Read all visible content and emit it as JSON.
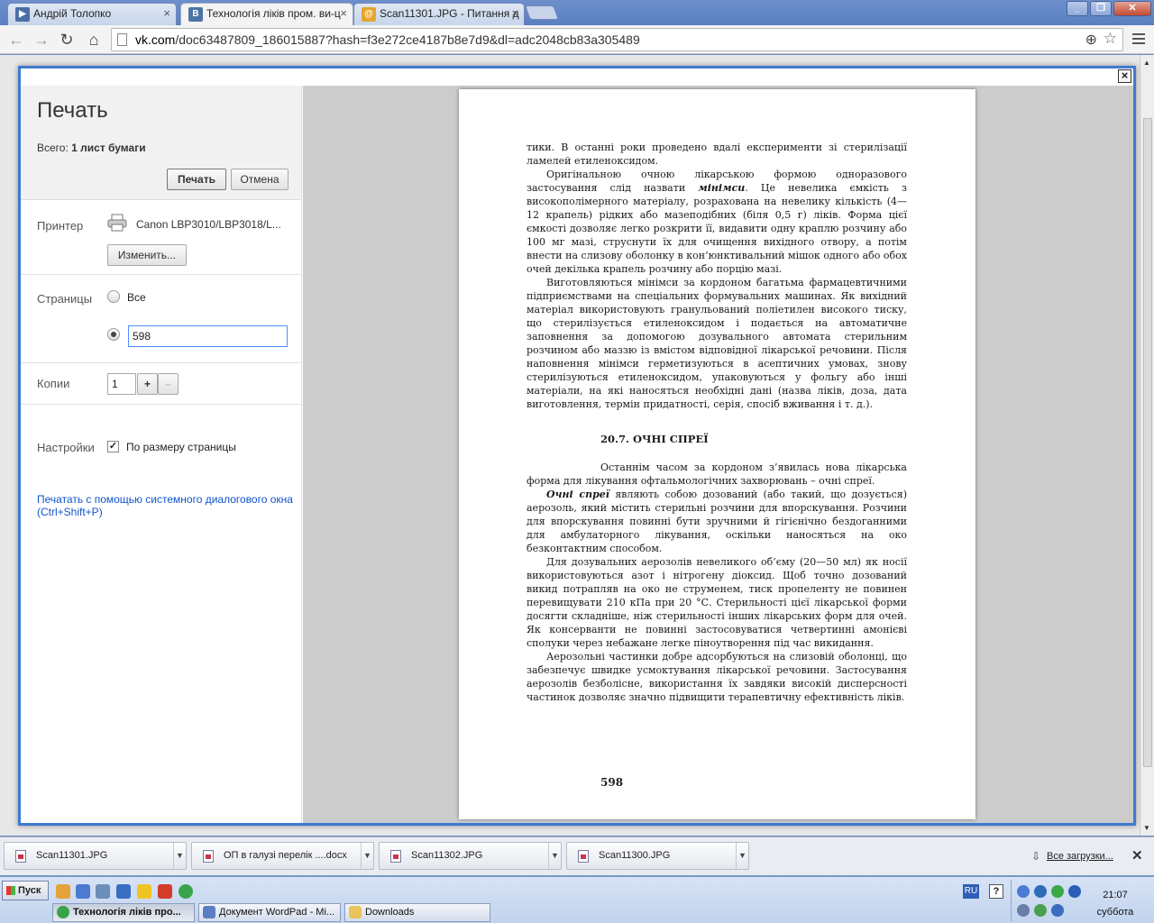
{
  "browser": {
    "tabs": [
      {
        "label": "Андрій Толопко",
        "active": false,
        "icon": "video-icon"
      },
      {
        "label": "Технологія ліків пром. ви-ц",
        "active": true,
        "icon": "vk-icon"
      },
      {
        "label": "Scan11301.JPG - Питання д",
        "active": false,
        "icon": "mail-icon"
      }
    ],
    "url_host": "vk.com",
    "url_rest": "/doc63487809_186015887?hash=f3e272ce4187b8e7d9&dl=adc2048cb83a305489"
  },
  "print": {
    "title": "Печать",
    "total_label": "Всего: ",
    "total_value": "1 лист бумаги",
    "print_button": "Печать",
    "cancel_button": "Отмена",
    "printer_label": "Принтер",
    "printer_name": "Canon LBP3010/LBP3018/L...",
    "change_button": "Изменить...",
    "pages_label": "Страницы",
    "pages_all": "Все",
    "pages_value": "598",
    "copies_label": "Копии",
    "copies_value": "1",
    "copies_plus": "+",
    "copies_minus": "–",
    "settings_label": "Настройки",
    "fit_label": "По размеру страницы",
    "fit_checked": true,
    "system_dialog_link": "Печатать с помощью системного диалогового окна (Ctrl+Shift+P)"
  },
  "document": {
    "p1": "тики. В останні роки проведено вдалі експерименти зі стерилізації ламелей етиленоксидом.",
    "p2a": "Оригінальною очною лікарською формою одноразового застосування слід назвати ",
    "p2b": "мінімси",
    "p2c": ". Це невелика ємкість з високополімерного матеріалу, розрахована на невелику кількість (4—12 крапель) рідких або мазеподібних (біля 0,5 г) ліків. Форма цієї ємкості дозволяє легко розкрити її, видавити одну краплю розчину або 100 мг мазі, струснути їх для очищення вихідного отвору, а потім внести на слизову оболонку в кон’юнктивальний мішок одного або обох очей декілька крапель розчину або порцію мазі.",
    "p3": "Виготовляються мінімси за кордоном багатьма фармацевтичними підприємствами на спеціальних формувальних машинах. Як вихідний матеріал використовують гранульований поліетилен високого тиску, що стерилізується етиленоксидом і подається на автоматичне заповнення за допомогою дозувального автомата стерильним розчином або маззю із вмістом відповідної лікарської речовини. Після наповнення мінімси герметизуються в асептичних умовах, знову стерилізуються етиленоксидом, упаковуються у фольгу або інші матеріали, на які наносяться необхідні дані (назва ліків, доза, дата виготовлення, термін придатності, серія, спосіб вживання і т. д.).",
    "heading": "20.7. ОЧНІ СПРЕЇ",
    "p4": "Останнім часом за кордоном з’явилась нова лікарська форма для лікування офтальмологічних захворювань – очні спреї.",
    "p5a": "Очні спреї",
    "p5b": " являють собою дозований (або такий, що дозується) аерозоль, який містить стерильні розчини для впорскування. Розчини для впорскування повинні бути зручними й гігієнічно бездоганними для амбулаторного лікування, оскільки наносяться на око безконтактним способом.",
    "p6": "Для дозувальних аерозолів невеликого об’єму (20—50 мл) як носії використовуються азот і нітрогену діоксид. Щоб точно дозований викид потрапляв на око не струменем, тиск пропеленту не повинен перевищувати 210 кПа при 20 °С. Стерильності цієї лікарської форми досягти складніше, ніж стерильності інших лікарських форм для очей. Як консерванти не повинні застосовуватися четвертинні амонієві сполуки через небажане легке піноутворення під час викидання.",
    "p7": "Аерозольні частинки добре адсорбуються на слизовій оболонці, що забезпечує швидке усмоктування лікарської речовини. Застосування аерозолів безболісне, використання їх завдяки високій дисперсності частинок дозволяє значно підвищити терапевтичну ефективність ліків.",
    "page_number": "598"
  },
  "downloads": {
    "items": [
      "Scan11301.JPG",
      "ОП в галузі перелік ....docx",
      "Scan11302.JPG",
      "Scan11300.JPG"
    ],
    "all_label": "Все загрузки..."
  },
  "taskbar": {
    "start": "Пуск",
    "tasks": [
      "Технологія ліків про...",
      "Документ WordPad - Mi...",
      "Downloads"
    ],
    "lang": "RU",
    "time": "21:07",
    "day": "суббота"
  }
}
